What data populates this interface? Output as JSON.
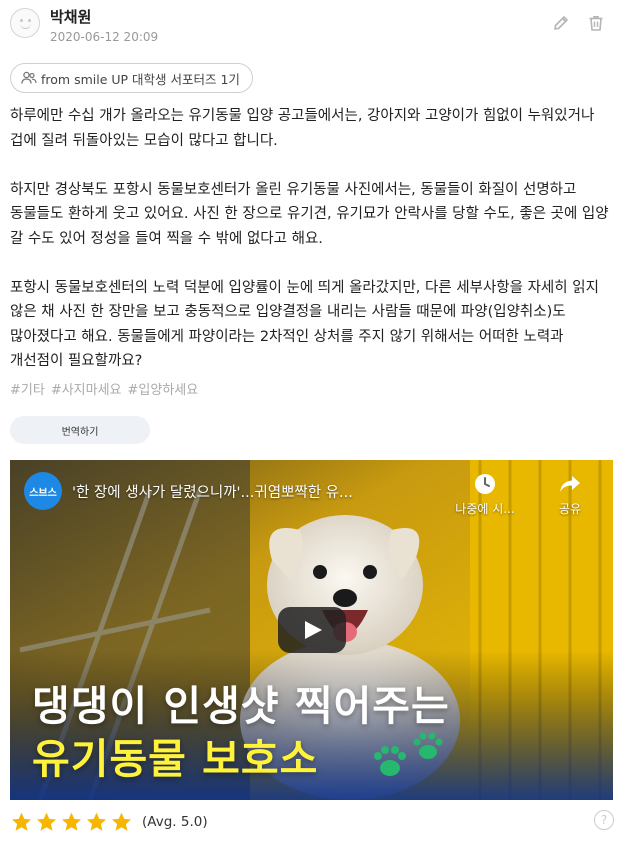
{
  "post": {
    "author": "박채원",
    "date": "2020-06-12 20:09",
    "source": "from smile UP 대학생 서포터즈 1기",
    "paragraphs": [
      "하루에만 수십 개가 올라오는 유기동물 입양 공고들에서는, 강아지와 고양이가 힘없이 누워있거나 겁에 질려 뒤돌아있는 모습이 많다고 합니다.",
      "하지만 경상북도 포항시 동물보호센터가 올린 유기동물 사진에서는, 동물들이 화질이 선명하고 동물들도 환하게 웃고 있어요. 사진 한 장으로 유기견, 유기묘가 안락사를 당할 수도, 좋은 곳에 입양 갈 수도 있어 정성을 들여 찍을 수 밖에 없다고 해요.",
      "포항시 동물보호센터의 노력 덕분에 입양률이 눈에 띄게 올라갔지만, 다른 세부사항을 자세히 읽지 않은 채 사진 한 장만을 보고 충동적으로 입양결정을 내리는 사람들 때문에 파양(입양취소)도 많아졌다고 해요. 동물들에게 파양이라는 2차적인 상처를 주지 않기 위해서는 어떠한 노력과 개선점이 필요할까요?"
    ],
    "tags": [
      "#기타",
      "#사지마세요",
      "#입양하세요"
    ],
    "translate_label": "번역하기"
  },
  "video": {
    "channel_logo_text": "스브스",
    "title": "'한 장에 생사가 달렸으니까'...귀염뽀짝한 유...",
    "watch_later_label": "나중에 시...",
    "share_label": "공유",
    "caption_line1": "댕댕이 인생샷 찍어주는",
    "caption_line2": "유기동물 보호소"
  },
  "rating": {
    "stars_filled": 5,
    "stars_total": 5,
    "avg_text": "(Avg. 5.0)",
    "help_glyph": "?"
  },
  "colors": {
    "star": "#f7b500",
    "caption_highlight": "#fff23a",
    "video_bg": "#e0b400"
  }
}
